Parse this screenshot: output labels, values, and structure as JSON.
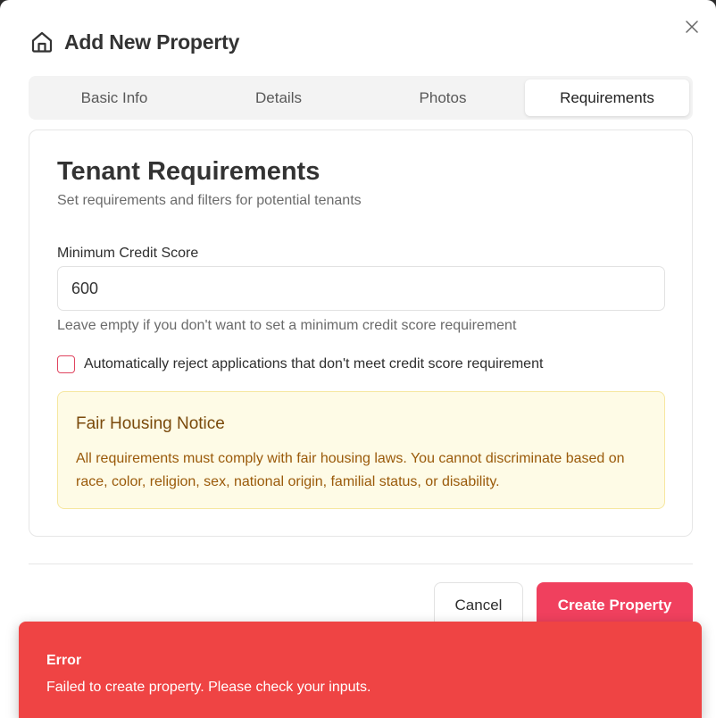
{
  "dialog": {
    "title": "Add New Property",
    "home_icon": "home-icon",
    "close_icon": "close-icon"
  },
  "tabs": [
    {
      "label": "Basic Info",
      "active": false
    },
    {
      "label": "Details",
      "active": false
    },
    {
      "label": "Photos",
      "active": false
    },
    {
      "label": "Requirements",
      "active": true
    }
  ],
  "requirements": {
    "title": "Tenant Requirements",
    "subtitle": "Set requirements and filters for potential tenants",
    "credit_label": "Minimum Credit Score",
    "credit_value": "600",
    "credit_help": "Leave empty if you don't want to set a minimum credit score requirement",
    "auto_reject_label": "Automatically reject applications that don't meet credit score requirement",
    "auto_reject_checked": false
  },
  "notice": {
    "title": "Fair Housing Notice",
    "text": "All requirements must comply with fair housing laws. You cannot discriminate based on race, color, religion, sex, national origin, familial status, or disability."
  },
  "footer": {
    "cancel_label": "Cancel",
    "create_label": "Create Property"
  },
  "toast": {
    "title": "Error",
    "message": "Failed to create property. Please check your inputs."
  },
  "colors": {
    "accent": "#f0405e",
    "error": "#ef4444",
    "notice_bg": "#fefbe6",
    "notice_text": "#9a5a0a"
  }
}
